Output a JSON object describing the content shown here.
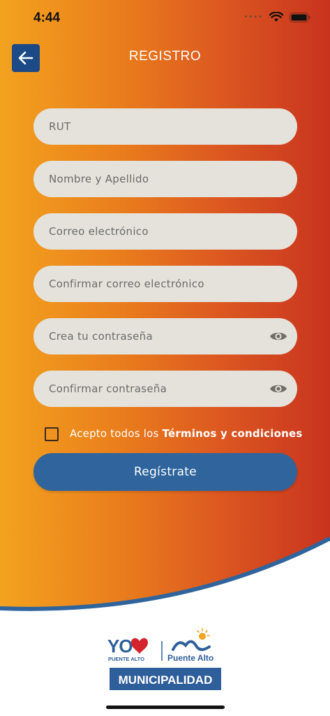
{
  "status_bar": {
    "time": "4:44",
    "icons": [
      "signal-dots-icon",
      "wifi-icon",
      "battery-icon"
    ]
  },
  "header": {
    "title": "REGISTRO",
    "back_icon": "arrow-left-icon"
  },
  "form": {
    "fields": [
      {
        "placeholder": "RUT"
      },
      {
        "placeholder": "Nombre y Apellido"
      },
      {
        "placeholder": "Correo electrónico"
      },
      {
        "placeholder": "Confirmar correo electrónico"
      },
      {
        "placeholder": "Crea tu contraseña",
        "icon": "eye-icon"
      },
      {
        "placeholder": "Confirmar contraseña",
        "icon": "eye-icon"
      }
    ],
    "terms_prefix": "Acepto todos los",
    "terms_link": "Términos y condiciones",
    "terms_checked": false,
    "submit_label": "Regístrate"
  },
  "footer": {
    "logo": {
      "yo_text": "YO",
      "yo_sub": "PUENTE ALTO",
      "city": "Puente Alto",
      "banner": "MUNICIPALIDAD"
    }
  },
  "colors": {
    "gradient": [
      "#f3a21f",
      "#c8331f"
    ],
    "primary_blue": "#2f659c",
    "back_button": "#1b4a86",
    "field_bg": "#e4e2da"
  }
}
